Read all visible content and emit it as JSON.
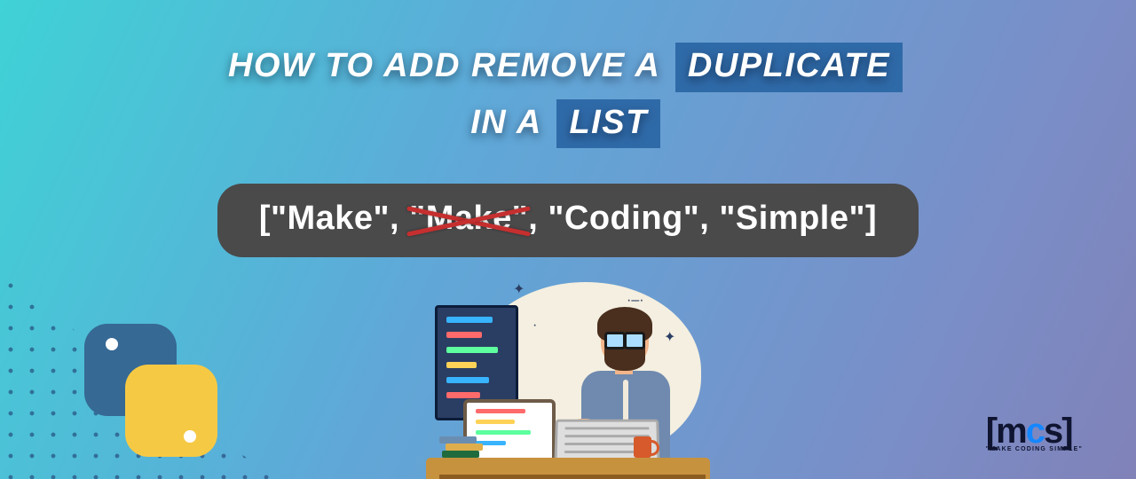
{
  "title": {
    "part1": "HOW TO ADD REMOVE A",
    "highlight1": "DUPLICATE",
    "part2": "IN A",
    "highlight2": "LIST"
  },
  "code": {
    "open": "[\"Make\", ",
    "struck": "\"Make\"",
    "rest": ", \"Coding\", \"Simple\"]"
  },
  "logo": {
    "bracket_open": "[",
    "m": "m",
    "c": "c",
    "s": "s",
    "bracket_close": "]",
    "tagline": "\"MAKE CODING SIMPLE\""
  }
}
